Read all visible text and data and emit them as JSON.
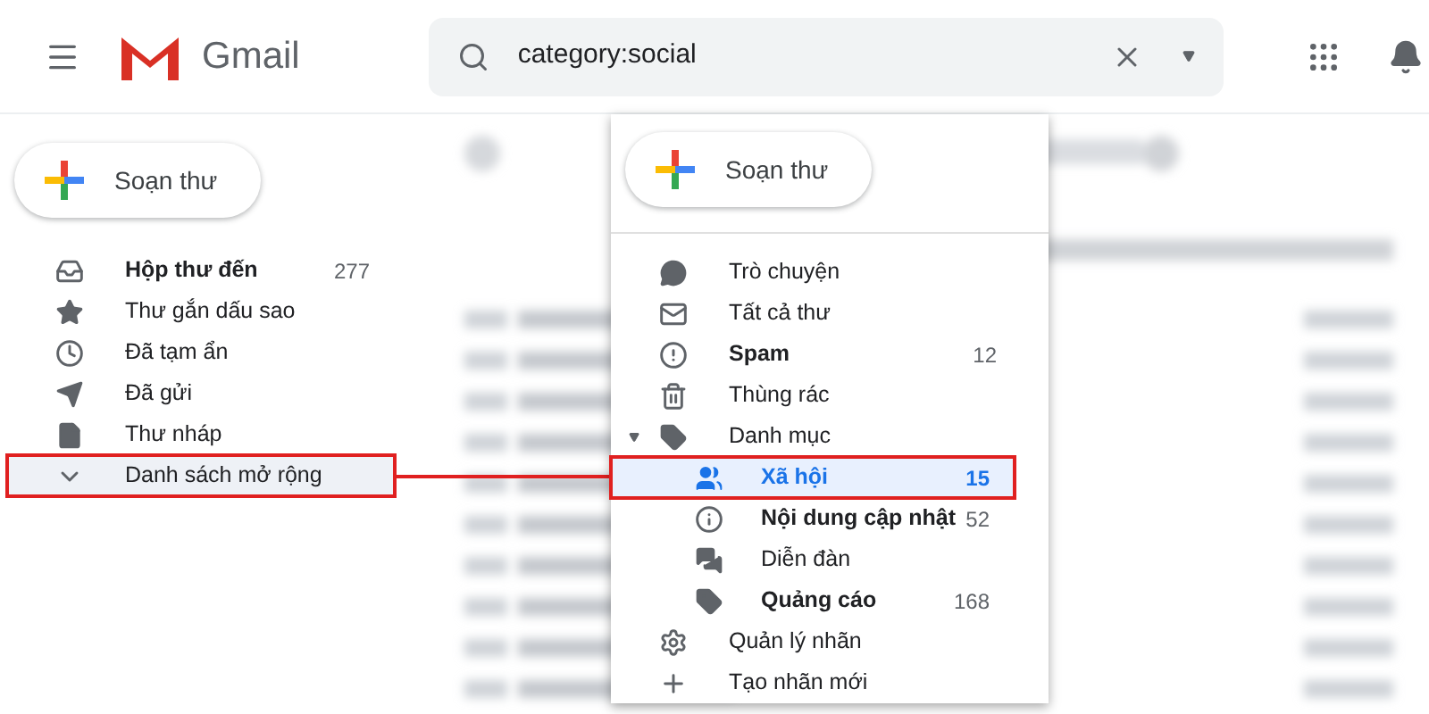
{
  "header": {
    "logo_text": "Gmail",
    "search_query": "category:social"
  },
  "sidebar": {
    "compose_label": "Soạn thư",
    "items": [
      {
        "label": "Hộp thư đến",
        "count": "277",
        "bold": true,
        "selected": false,
        "annotated": false
      },
      {
        "label": "Thư gắn dấu sao",
        "bold": false,
        "selected": false,
        "annotated": false
      },
      {
        "label": "Đã tạm ẩn",
        "bold": false,
        "selected": false,
        "annotated": false
      },
      {
        "label": "Đã gửi",
        "bold": false,
        "selected": false,
        "annotated": false
      },
      {
        "label": "Thư nháp",
        "bold": false,
        "selected": false,
        "annotated": false
      },
      {
        "label": "Danh sách mở rộng",
        "bold": false,
        "selected": true,
        "annotated": true
      }
    ]
  },
  "overlay": {
    "compose_label": "Soạn thư",
    "items": [
      {
        "label": "Trò chuyện",
        "bold": false,
        "selected": false,
        "annotated": false
      },
      {
        "label": "Tất cả thư",
        "bold": false,
        "selected": false,
        "annotated": false
      },
      {
        "label": "Spam",
        "count": "12",
        "bold": true,
        "selected": false,
        "annotated": false
      },
      {
        "label": "Thùng rác",
        "bold": false,
        "selected": false,
        "annotated": false
      },
      {
        "label": "Danh mục",
        "bold": false,
        "selected": false,
        "annotated": false,
        "expanded": true,
        "children": [
          {
            "label": "Xã hội",
            "count": "15",
            "bold": true,
            "selected": true,
            "annotated": true
          },
          {
            "label": "Nội dung cập nhật",
            "count": "52",
            "bold": true,
            "selected": false,
            "annotated": false
          },
          {
            "label": "Diễn đàn",
            "bold": false,
            "selected": false,
            "annotated": false
          },
          {
            "label": "Quảng cáo",
            "count": "168",
            "bold": true,
            "selected": false,
            "annotated": false
          }
        ]
      },
      {
        "label": "Quản lý nhãn",
        "bold": false,
        "selected": false,
        "annotated": false
      },
      {
        "label": "Tạo nhãn mới",
        "bold": false,
        "selected": false,
        "annotated": false
      }
    ]
  }
}
